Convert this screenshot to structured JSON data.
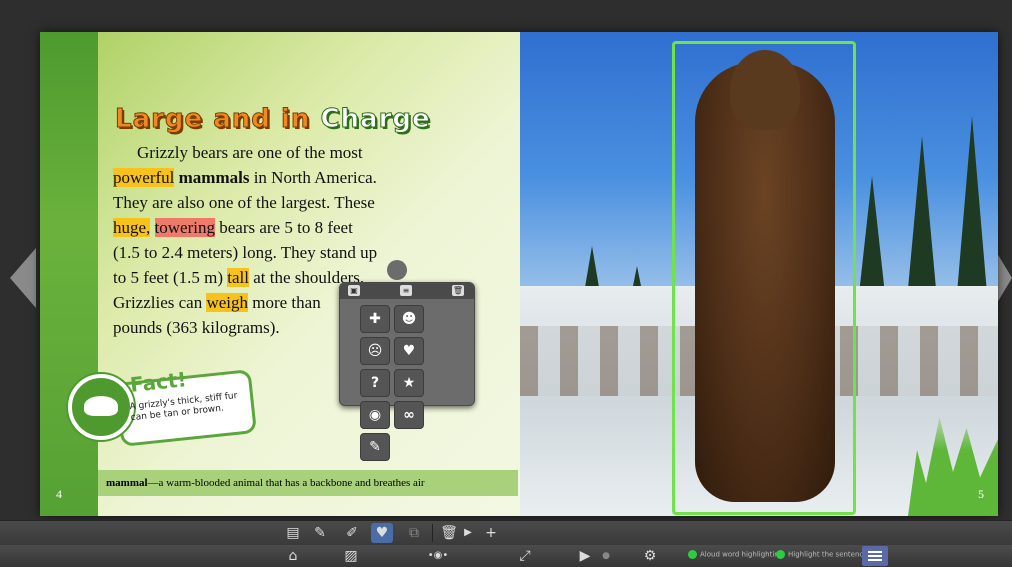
{
  "book": {
    "title_part1": "Large and in",
    "title_part2": "Charge",
    "paragraph": {
      "line1": "Grizzly bears are one of the most",
      "w_powerful": "powerful",
      "w_mammals": "mammals",
      "line2_rest": " in North America.",
      "line3": "They are also one of the largest. These",
      "w_huge": "huge,",
      "w_towering": "towering",
      "line4_rest": " bears are 5 to 8 feet",
      "line5": "(1.5 to 2.4 meters) long. They stand up",
      "line6_a": "to 5 feet (1.5 m) ",
      "w_tall": "tall",
      "line6_b": " at the shoulders.",
      "line7_a": "Grizzlies can ",
      "w_weigh": "weigh",
      "line7_b": " more than",
      "line8": "pounds (363 kilograms)."
    },
    "fact_title": "Fact!",
    "fact_text": "A grizzly's thick, stiff fur can be tan or brown.",
    "glossary_term": "mammal",
    "glossary_def": "—a warm-blooded animal that has a backbone and breathes air",
    "page_left": "4",
    "page_right": "5"
  },
  "popup": {
    "icons": [
      "pin-icon",
      "smiley-icon",
      "surprised-icon",
      "heart-icon",
      "question-icon",
      "star-icon",
      "eye-icon",
      "link-icon",
      "speech-icon"
    ],
    "glyphs": [
      "✚",
      "☻",
      "☹",
      "♥",
      "?",
      "★",
      "◉",
      "∞",
      "✎"
    ]
  },
  "toolbar": {
    "opt_word": "Aloud word highlighting",
    "opt_sentence": "Highlight the sentence",
    "accent": "#4a6da8",
    "active_color": "#2ecc40"
  }
}
